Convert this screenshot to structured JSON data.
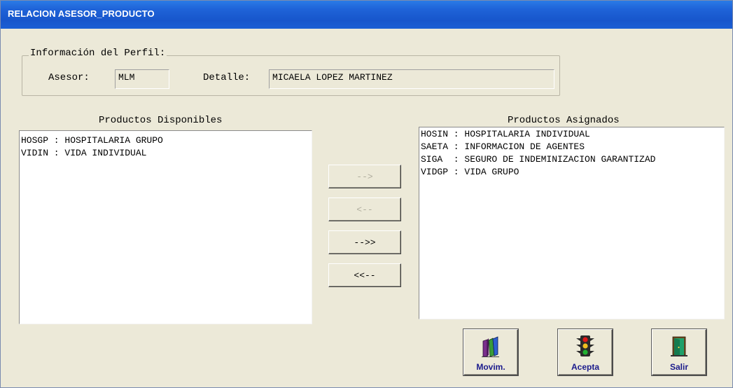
{
  "window": {
    "title": "RELACION ASESOR_PRODUCTO"
  },
  "profile": {
    "legend": "Información del Perfil:",
    "asesor_label": "Asesor:",
    "asesor_value": "MLM",
    "detalle_label": "Detalle:",
    "detalle_value": "MICAELA LOPEZ MARTINEZ"
  },
  "available": {
    "header": "Productos Disponibles",
    "items": [
      "HOSGP : HOSPITALARIA GRUPO",
      "VIDIN : VIDA INDIVIDUAL"
    ]
  },
  "assigned": {
    "header": "Productos Asignados",
    "items": [
      "HOSIN : HOSPITALARIA INDIVIDUAL",
      "SAETA : INFORMACION DE AGENTES",
      "SIGA  : SEGURO DE INDEMINIZACION GARANTIZAD",
      "VIDGP : VIDA GRUPO"
    ]
  },
  "move_buttons": {
    "add_one": "-->",
    "remove_one": "<--",
    "add_all": "-->>",
    "remove_all": "<<--"
  },
  "actions": {
    "movim": {
      "label": "Movim.",
      "icon": "books-icon"
    },
    "acepta": {
      "label": "Acepta",
      "icon": "traffic-light-icon"
    },
    "salir": {
      "label": "Salir",
      "icon": "exit-door-icon"
    }
  },
  "colors": {
    "title_bar": "#1f63d8",
    "window_bg": "#ece9d8",
    "button_text": "#1a1a8c"
  }
}
